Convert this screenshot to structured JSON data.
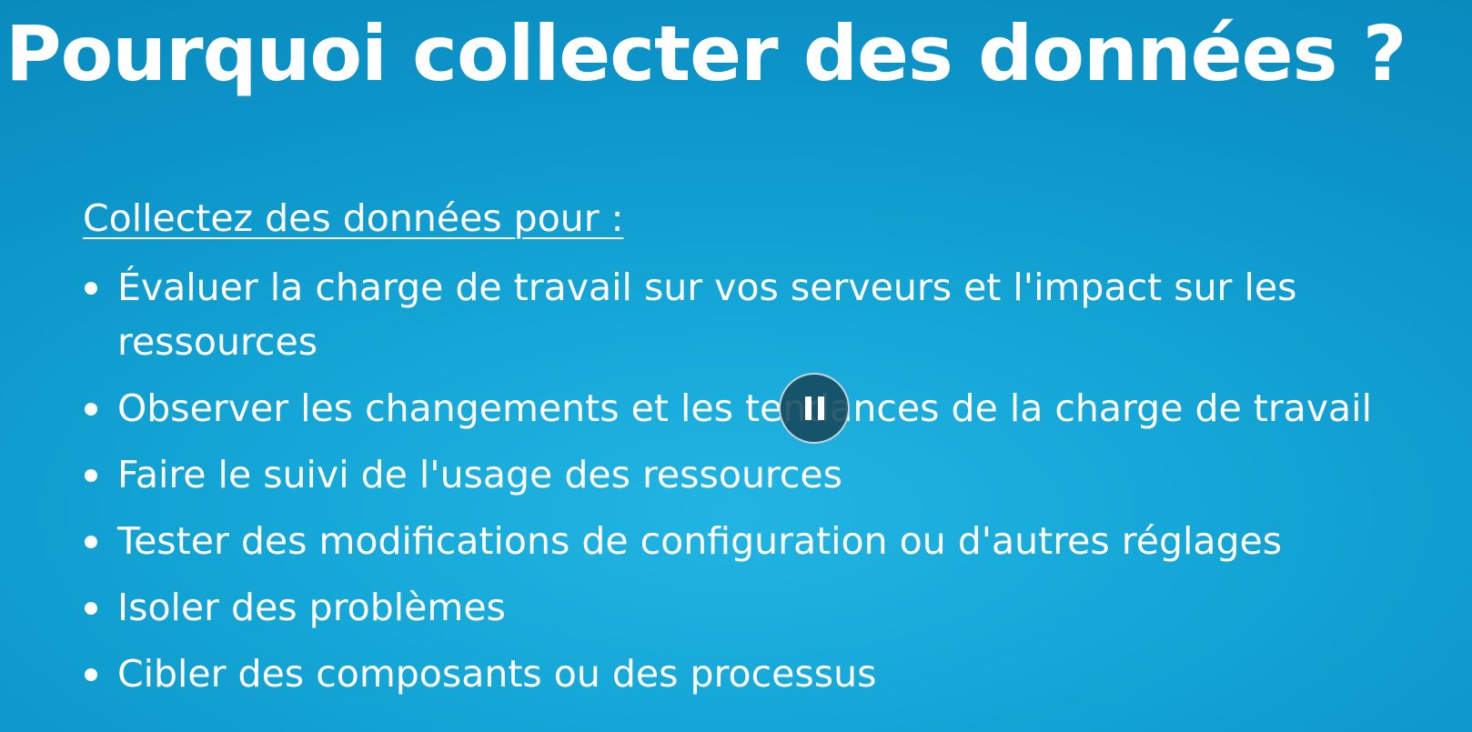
{
  "slide": {
    "title": "Pourquoi collecter des données ?",
    "subheading": "Collectez des données pour :",
    "bullets": [
      "Évaluer la charge de travail sur vos serveurs et l'impact sur les ressources",
      "Observer les changements et les tendances de la charge de travail",
      "Faire le suivi de l'usage des ressources",
      "Tester des modifications de configuration ou d'autres réglages",
      "Isoler des problèmes",
      "Cibler des composants ou des processus"
    ],
    "background_color": "#14a6d6",
    "text_color": "#ffffff"
  },
  "player": {
    "control_icon": "pause-icon",
    "state": "playing"
  }
}
